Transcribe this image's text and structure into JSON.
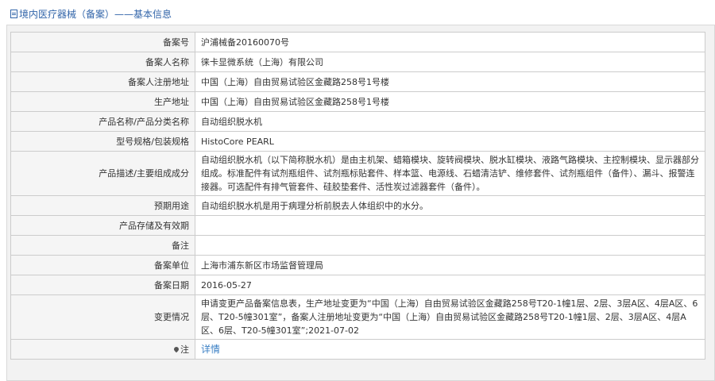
{
  "page": {
    "breadcrumb_main": "境内医疗器械（备案）",
    "breadcrumb_sep": "——",
    "breadcrumb_sub": "基本信息"
  },
  "rows": [
    {
      "label": "备案号",
      "value": "沪浦械备20160070号"
    },
    {
      "label": "备案人名称",
      "value": "徕卡显微系统（上海）有限公司"
    },
    {
      "label": "备案人注册地址",
      "value": "中国（上海）自由贸易试验区金藏路258号1号楼"
    },
    {
      "label": "生产地址",
      "value": "中国（上海）自由贸易试验区金藏路258号1号楼"
    },
    {
      "label": "产品名称/产品分类名称",
      "value": "自动组织脱水机"
    },
    {
      "label": "型号规格/包装规格",
      "value": "HistoCore PEARL"
    },
    {
      "label": "产品描述/主要组成成分",
      "value": "自动组织脱水机（以下简称脱水机）是由主机架、蜡箱模块、旋转阀模块、脱水缸模块、液路气路模块、主控制模块、显示器部分组成。标准配件有试剂瓶组件、试剂瓶标贴套件、样本篮、电源线、石蜡清洁铲、维修套件、试剂瓶组件（备件）、漏斗、报警连接器。可选配件有排气管套件、硅胶垫套件、活性炭过滤器套件（备件）。"
    },
    {
      "label": "预期用途",
      "value": "自动组织脱水机是用于病理分析前脱去人体组织中的水分。"
    },
    {
      "label": "产品存储及有效期",
      "value": ""
    },
    {
      "label": "备注",
      "value": ""
    },
    {
      "label": "备案单位",
      "value": "上海市浦东新区市场监督管理局"
    },
    {
      "label": "备案日期",
      "value": "2016-05-27"
    },
    {
      "label": "变更情况",
      "value": "申请变更产品备案信息表，生产地址变更为“中国（上海）自由贸易试验区金藏路258号T20-1幢1层、2层、3层A区、4层A区、6层、T20-5幢301室”，备案人注册地址变更为“中国（上海）自由贸易试验区金藏路258号T20-1幢1层、2层、3层A区、4层A区、6层、T20-5幢301室”;2021-07-02"
    },
    {
      "label": "注",
      "value": "详情"
    }
  ]
}
